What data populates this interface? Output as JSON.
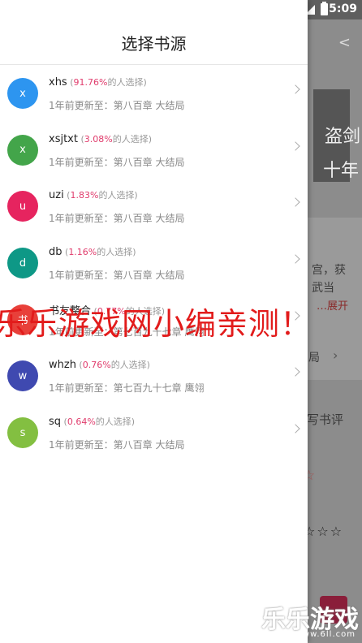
{
  "status_bar": {
    "time": "5:09"
  },
  "background": {
    "cover_line1": "盗剑",
    "cover_line2": "十年",
    "desc_line1": "宫，获",
    "desc_line2": "武当",
    "expand": "…展开",
    "chapter": "局",
    "review_label": "写书评"
  },
  "drawer": {
    "title": "选择书源",
    "sources": [
      {
        "letter": "x",
        "name": "xhs",
        "pct": "91.76%",
        "suffix": "的人选择)",
        "update": "1年前更新至：第八百章 大结局",
        "color": "#2d95f0"
      },
      {
        "letter": "x",
        "name": "xsjtxt",
        "pct": "3.08%",
        "suffix": "的人选择)",
        "update": "1年前更新至：第八百章 大结局",
        "color": "#43a54a"
      },
      {
        "letter": "u",
        "name": "uzi",
        "pct": "1.83%",
        "suffix": "的人选择)",
        "update": "1年前更新至：第八百章 大结局",
        "color": "#e6245f"
      },
      {
        "letter": "d",
        "name": "db",
        "pct": "1.16%",
        "suffix": "的人选择)",
        "update": "1年前更新至：第八百章 大结局",
        "color": "#0e9886"
      },
      {
        "letter": "书",
        "name": "书友整合",
        "pct": "0.77%",
        "suffix": "的人选择)",
        "update": "1年前更新至：第七百九十七章 鹰翎",
        "color": "#e8403a"
      },
      {
        "letter": "w",
        "name": "whzh",
        "pct": "0.76%",
        "suffix": "的人选择)",
        "update": "1年前更新至：第七百九十七章 鹰翎",
        "color": "#3f49b0"
      },
      {
        "letter": "s",
        "name": "sq",
        "pct": "0.64%",
        "suffix": "的人选择)",
        "update": "1年前更新至：第八百章 大结局",
        "color": "#83bf41"
      }
    ]
  },
  "watermark": {
    "caption": "乐乐游戏网小编亲测！",
    "logo": "乐乐游戏",
    "url": "www.6ll.com"
  }
}
